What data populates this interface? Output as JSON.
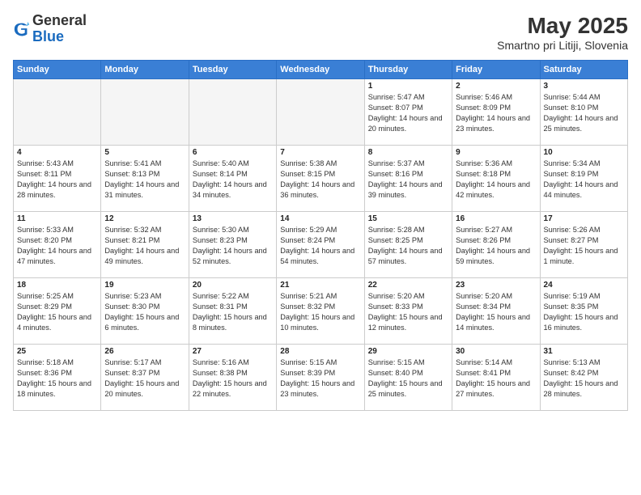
{
  "header": {
    "logo_general": "General",
    "logo_blue": "Blue",
    "title": "May 2025",
    "location": "Smartno pri Litiji, Slovenia"
  },
  "days": [
    "Sunday",
    "Monday",
    "Tuesday",
    "Wednesday",
    "Thursday",
    "Friday",
    "Saturday"
  ],
  "weeks": [
    [
      {
        "date": "",
        "info": ""
      },
      {
        "date": "",
        "info": ""
      },
      {
        "date": "",
        "info": ""
      },
      {
        "date": "",
        "info": ""
      },
      {
        "date": "1",
        "info": "Sunrise: 5:47 AM\nSunset: 8:07 PM\nDaylight: 14 hours and 20 minutes."
      },
      {
        "date": "2",
        "info": "Sunrise: 5:46 AM\nSunset: 8:09 PM\nDaylight: 14 hours and 23 minutes."
      },
      {
        "date": "3",
        "info": "Sunrise: 5:44 AM\nSunset: 8:10 PM\nDaylight: 14 hours and 25 minutes."
      }
    ],
    [
      {
        "date": "4",
        "info": "Sunrise: 5:43 AM\nSunset: 8:11 PM\nDaylight: 14 hours and 28 minutes."
      },
      {
        "date": "5",
        "info": "Sunrise: 5:41 AM\nSunset: 8:13 PM\nDaylight: 14 hours and 31 minutes."
      },
      {
        "date": "6",
        "info": "Sunrise: 5:40 AM\nSunset: 8:14 PM\nDaylight: 14 hours and 34 minutes."
      },
      {
        "date": "7",
        "info": "Sunrise: 5:38 AM\nSunset: 8:15 PM\nDaylight: 14 hours and 36 minutes."
      },
      {
        "date": "8",
        "info": "Sunrise: 5:37 AM\nSunset: 8:16 PM\nDaylight: 14 hours and 39 minutes."
      },
      {
        "date": "9",
        "info": "Sunrise: 5:36 AM\nSunset: 8:18 PM\nDaylight: 14 hours and 42 minutes."
      },
      {
        "date": "10",
        "info": "Sunrise: 5:34 AM\nSunset: 8:19 PM\nDaylight: 14 hours and 44 minutes."
      }
    ],
    [
      {
        "date": "11",
        "info": "Sunrise: 5:33 AM\nSunset: 8:20 PM\nDaylight: 14 hours and 47 minutes."
      },
      {
        "date": "12",
        "info": "Sunrise: 5:32 AM\nSunset: 8:21 PM\nDaylight: 14 hours and 49 minutes."
      },
      {
        "date": "13",
        "info": "Sunrise: 5:30 AM\nSunset: 8:23 PM\nDaylight: 14 hours and 52 minutes."
      },
      {
        "date": "14",
        "info": "Sunrise: 5:29 AM\nSunset: 8:24 PM\nDaylight: 14 hours and 54 minutes."
      },
      {
        "date": "15",
        "info": "Sunrise: 5:28 AM\nSunset: 8:25 PM\nDaylight: 14 hours and 57 minutes."
      },
      {
        "date": "16",
        "info": "Sunrise: 5:27 AM\nSunset: 8:26 PM\nDaylight: 14 hours and 59 minutes."
      },
      {
        "date": "17",
        "info": "Sunrise: 5:26 AM\nSunset: 8:27 PM\nDaylight: 15 hours and 1 minute."
      }
    ],
    [
      {
        "date": "18",
        "info": "Sunrise: 5:25 AM\nSunset: 8:29 PM\nDaylight: 15 hours and 4 minutes."
      },
      {
        "date": "19",
        "info": "Sunrise: 5:23 AM\nSunset: 8:30 PM\nDaylight: 15 hours and 6 minutes."
      },
      {
        "date": "20",
        "info": "Sunrise: 5:22 AM\nSunset: 8:31 PM\nDaylight: 15 hours and 8 minutes."
      },
      {
        "date": "21",
        "info": "Sunrise: 5:21 AM\nSunset: 8:32 PM\nDaylight: 15 hours and 10 minutes."
      },
      {
        "date": "22",
        "info": "Sunrise: 5:20 AM\nSunset: 8:33 PM\nDaylight: 15 hours and 12 minutes."
      },
      {
        "date": "23",
        "info": "Sunrise: 5:20 AM\nSunset: 8:34 PM\nDaylight: 15 hours and 14 minutes."
      },
      {
        "date": "24",
        "info": "Sunrise: 5:19 AM\nSunset: 8:35 PM\nDaylight: 15 hours and 16 minutes."
      }
    ],
    [
      {
        "date": "25",
        "info": "Sunrise: 5:18 AM\nSunset: 8:36 PM\nDaylight: 15 hours and 18 minutes."
      },
      {
        "date": "26",
        "info": "Sunrise: 5:17 AM\nSunset: 8:37 PM\nDaylight: 15 hours and 20 minutes."
      },
      {
        "date": "27",
        "info": "Sunrise: 5:16 AM\nSunset: 8:38 PM\nDaylight: 15 hours and 22 minutes."
      },
      {
        "date": "28",
        "info": "Sunrise: 5:15 AM\nSunset: 8:39 PM\nDaylight: 15 hours and 23 minutes."
      },
      {
        "date": "29",
        "info": "Sunrise: 5:15 AM\nSunset: 8:40 PM\nDaylight: 15 hours and 25 minutes."
      },
      {
        "date": "30",
        "info": "Sunrise: 5:14 AM\nSunset: 8:41 PM\nDaylight: 15 hours and 27 minutes."
      },
      {
        "date": "31",
        "info": "Sunrise: 5:13 AM\nSunset: 8:42 PM\nDaylight: 15 hours and 28 minutes."
      }
    ]
  ]
}
